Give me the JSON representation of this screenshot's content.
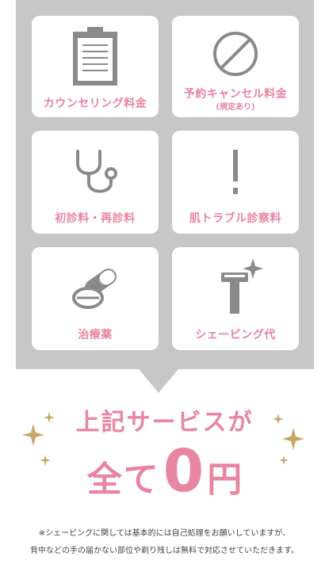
{
  "cards": [
    {
      "label": "カウンセリング料金",
      "icon": "clipboard-icon"
    },
    {
      "label": "予約キャンセル料金",
      "sublabel": "(規定あり)",
      "icon": "prohibited-icon"
    },
    {
      "label": "初診料・再診料",
      "icon": "stethoscope-icon"
    },
    {
      "label": "肌トラブル診察料",
      "icon": "exclamation-icon"
    },
    {
      "label": "治療薬",
      "icon": "pills-icon"
    },
    {
      "label": "シェービング代",
      "icon": "razor-icon"
    }
  ],
  "headline": {
    "line1": "上記サービスが",
    "line2_kana": "全て",
    "line2_zero": "0",
    "line2_yen": "円"
  },
  "notes": [
    "※シェービングに関しては基本的には自己処理をお願いしていますが、",
    "背中などの手の届かない部位や剃り残しは無料で対応させていただきます。"
  ],
  "colors": {
    "accent": "#e8859f",
    "panel": "#c7c7c7",
    "icon": "#8a8a8a",
    "sparkle": "#c9a767"
  }
}
